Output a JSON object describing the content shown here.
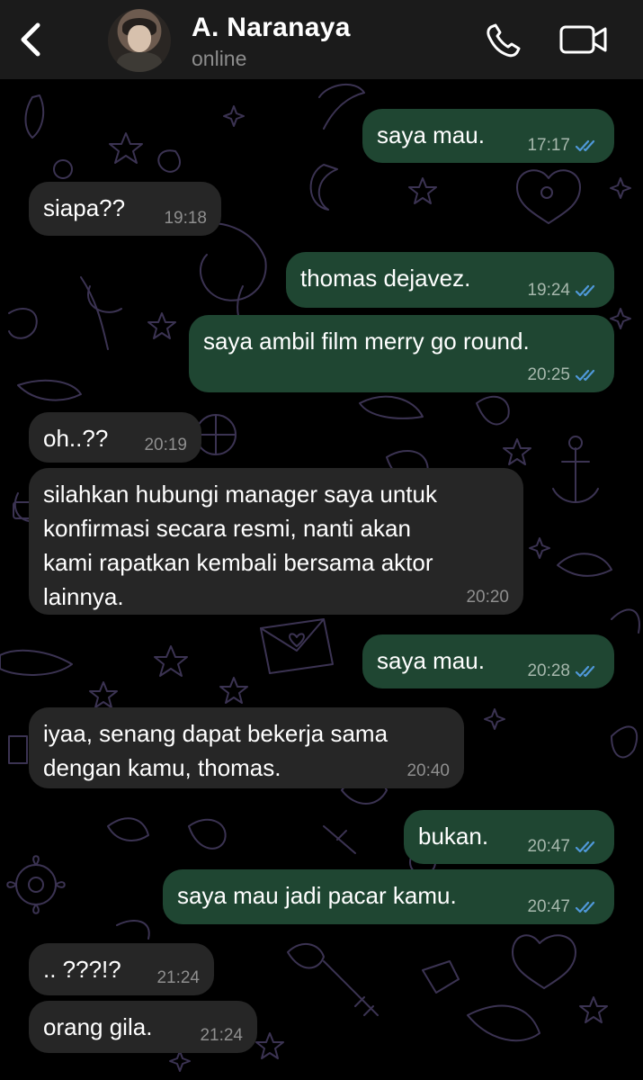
{
  "header": {
    "contact_name": "A. Naranaya",
    "status": "online",
    "icons": [
      "back-icon",
      "avatar",
      "phone-icon",
      "video-icon"
    ]
  },
  "messages": [
    {
      "direction": "outgoing",
      "text": "saya mau.",
      "time": "17:17",
      "read": true
    },
    {
      "direction": "incoming",
      "text": "siapa??",
      "time": "19:18"
    },
    {
      "direction": "outgoing",
      "text": "thomas dejavez.",
      "time": "19:24",
      "read": true
    },
    {
      "direction": "outgoing",
      "text": "saya ambil film merry go round.",
      "time": "20:25",
      "read": true
    },
    {
      "direction": "incoming",
      "text": "oh..??",
      "time": "20:19"
    },
    {
      "direction": "incoming",
      "text": "silahkan hubungi manager saya untuk\nkonfirmasi secara resmi, nanti akan\nkami rapatkan kembali bersama aktor\nlainnya.",
      "time": "20:20"
    },
    {
      "direction": "outgoing",
      "text": "saya mau.",
      "time": "20:28",
      "read": true
    },
    {
      "direction": "incoming",
      "text": "iyaa, senang dapat bekerja sama\ndengan kamu, thomas.",
      "time": "20:40"
    },
    {
      "direction": "outgoing",
      "text": "bukan.",
      "time": "20:47",
      "read": true
    },
    {
      "direction": "outgoing",
      "text": "saya mau jadi pacar kamu.",
      "time": "20:47",
      "read": true
    },
    {
      "direction": "incoming",
      "text": ".. ???!?",
      "time": "21:24"
    },
    {
      "direction": "incoming",
      "text": "orang gila.",
      "time": "21:24"
    }
  ],
  "colors": {
    "background": "#000000",
    "header": "#1b1b1b",
    "incoming_bubble": "#262626",
    "outgoing_bubble": "#1f4632",
    "read_ticks": "#4f98d9",
    "wallpaper_doodles": "#3b3352"
  }
}
